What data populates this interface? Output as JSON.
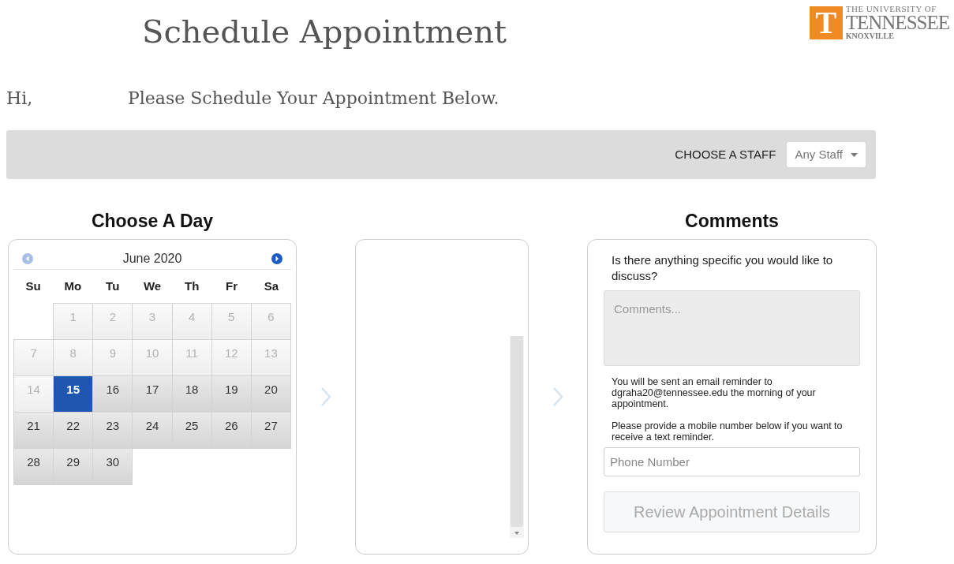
{
  "header": {
    "title": "Schedule Appointment",
    "logo": {
      "mark": "T",
      "line1": "THE UNIVERSITY OF",
      "line2": "TENNESSEE",
      "line3": "KNOXVILLE"
    }
  },
  "greeting": {
    "hi": "Hi,",
    "message": "Please Schedule Your Appointment Below."
  },
  "staff_bar": {
    "label": "CHOOSE A STAFF",
    "value": "Any Staff"
  },
  "day_panel": {
    "heading": "Choose A Day",
    "month": "June 2020",
    "prev_disabled": true,
    "next_disabled": false,
    "weekdays": [
      "Su",
      "Mo",
      "Tu",
      "We",
      "Th",
      "Fr",
      "Sa"
    ],
    "weeks": [
      [
        {
          "kind": "blank"
        },
        {
          "kind": "day",
          "text": "1",
          "disabled": true,
          "selected": false
        },
        {
          "kind": "day",
          "text": "2",
          "disabled": true,
          "selected": false
        },
        {
          "kind": "day",
          "text": "3",
          "disabled": true,
          "selected": false
        },
        {
          "kind": "day",
          "text": "4",
          "disabled": true,
          "selected": false
        },
        {
          "kind": "day",
          "text": "5",
          "disabled": true,
          "selected": false
        },
        {
          "kind": "day",
          "text": "6",
          "disabled": true,
          "selected": false
        }
      ],
      [
        {
          "kind": "day",
          "text": "7",
          "disabled": true,
          "selected": false
        },
        {
          "kind": "day",
          "text": "8",
          "disabled": true,
          "selected": false
        },
        {
          "kind": "day",
          "text": "9",
          "disabled": true,
          "selected": false
        },
        {
          "kind": "day",
          "text": "10",
          "disabled": true,
          "selected": false
        },
        {
          "kind": "day",
          "text": "11",
          "disabled": true,
          "selected": false
        },
        {
          "kind": "day",
          "text": "12",
          "disabled": true,
          "selected": false
        },
        {
          "kind": "day",
          "text": "13",
          "disabled": true,
          "selected": false
        }
      ],
      [
        {
          "kind": "day",
          "text": "14",
          "disabled": true,
          "selected": false
        },
        {
          "kind": "day",
          "text": "15",
          "disabled": false,
          "selected": true
        },
        {
          "kind": "day",
          "text": "16",
          "disabled": false,
          "selected": false
        },
        {
          "kind": "day",
          "text": "17",
          "disabled": false,
          "selected": false
        },
        {
          "kind": "day",
          "text": "18",
          "disabled": false,
          "selected": false
        },
        {
          "kind": "day",
          "text": "19",
          "disabled": false,
          "selected": false
        },
        {
          "kind": "day",
          "text": "20",
          "disabled": false,
          "selected": false
        }
      ],
      [
        {
          "kind": "day",
          "text": "21",
          "disabled": false,
          "selected": false
        },
        {
          "kind": "day",
          "text": "22",
          "disabled": false,
          "selected": false
        },
        {
          "kind": "day",
          "text": "23",
          "disabled": false,
          "selected": false
        },
        {
          "kind": "day",
          "text": "24",
          "disabled": false,
          "selected": false
        },
        {
          "kind": "day",
          "text": "25",
          "disabled": false,
          "selected": false
        },
        {
          "kind": "day",
          "text": "26",
          "disabled": false,
          "selected": false
        },
        {
          "kind": "day",
          "text": "27",
          "disabled": false,
          "selected": false
        }
      ],
      [
        {
          "kind": "day",
          "text": "28",
          "disabled": false,
          "selected": false
        },
        {
          "kind": "day",
          "text": "29",
          "disabled": false,
          "selected": false
        },
        {
          "kind": "day",
          "text": "30",
          "disabled": false,
          "selected": false
        },
        {
          "kind": "blank"
        },
        {
          "kind": "blank"
        },
        {
          "kind": "blank"
        },
        {
          "kind": "blank"
        }
      ]
    ]
  },
  "comments_panel": {
    "heading": "Comments",
    "question": "Is there anything specific you would like to discuss?",
    "comments_placeholder": "Comments...",
    "email_note": "You will be sent an email reminder to dgraha20@tennessee.edu the morning of your appointment.",
    "mobile_note": "Please provide a mobile number below if you want to receive a text reminder.",
    "phone_placeholder": "Phone Number",
    "review_button": {
      "label": "Review Appointment Details",
      "disabled": true
    }
  }
}
